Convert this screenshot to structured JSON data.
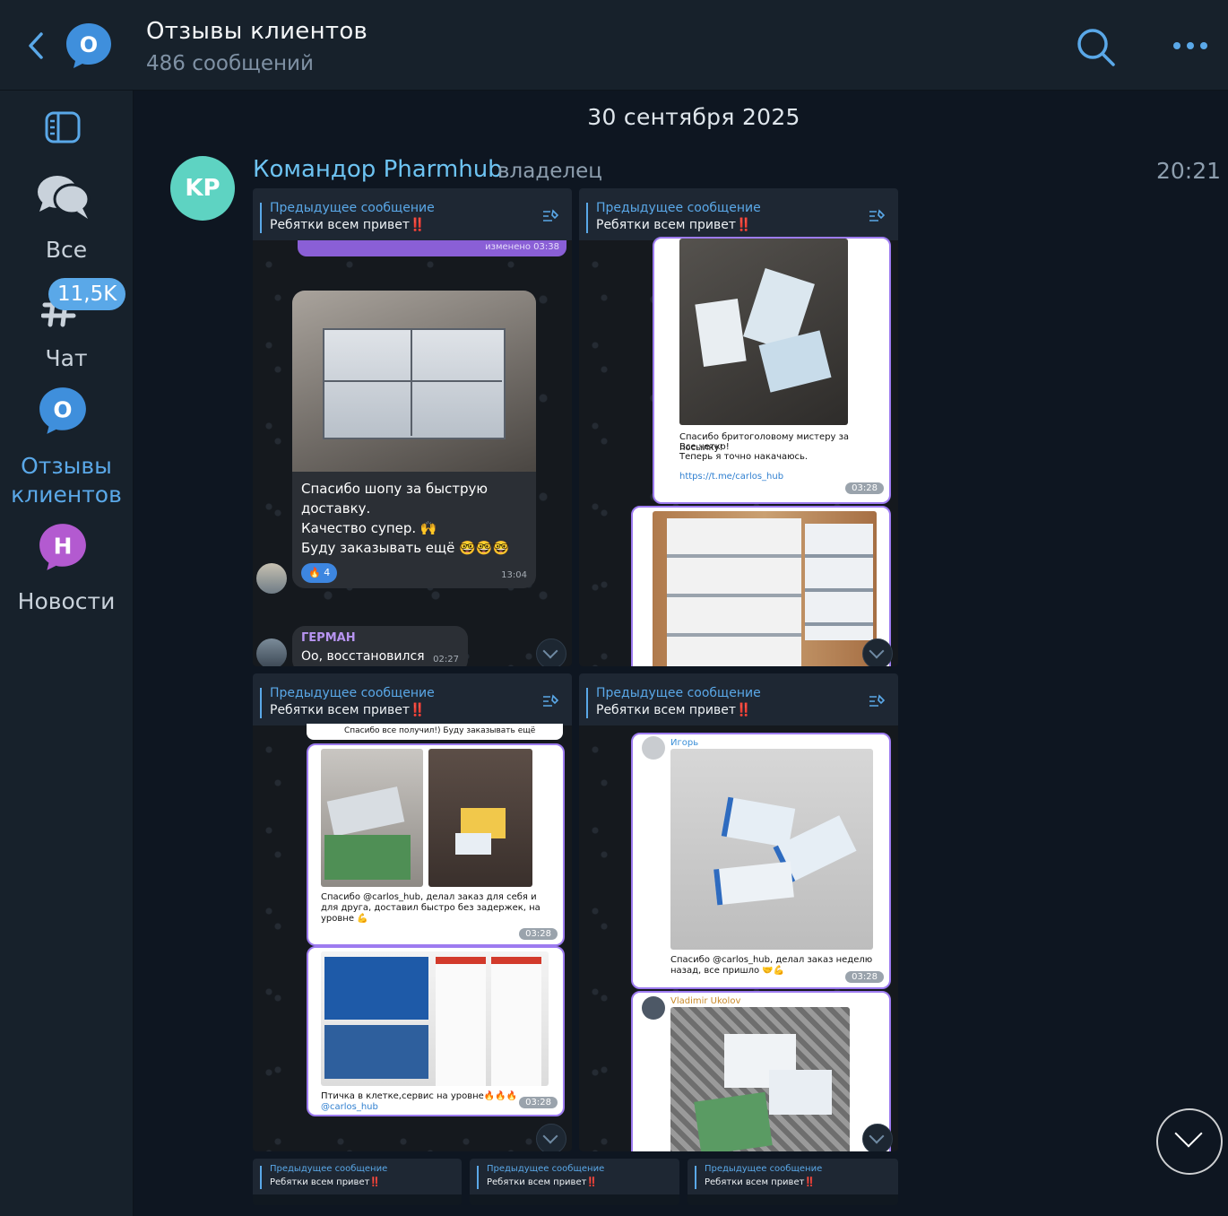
{
  "header": {
    "title": "Отзывы клиентов",
    "subtitle": "486 сообщений",
    "avatar_letter": "О"
  },
  "sidebar": {
    "folders": [
      {
        "label": "Все",
        "icon": "chats-icon"
      },
      {
        "label": "Чат",
        "icon": "hashtag-icon",
        "badge": "11,5K"
      },
      {
        "label": "Отзывы клиентов",
        "icon": "channel-avatar-o",
        "letter": "О",
        "active": true
      },
      {
        "label": "Новости",
        "icon": "channel-avatar-h",
        "letter": "Н"
      }
    ]
  },
  "chat": {
    "date": "30 сентября 2025",
    "message": {
      "avatar_initials": "KP",
      "sender": "Командор Pharmhub",
      "role": "владелец",
      "time": "20:21"
    },
    "pinned": {
      "title": "Предыдущее сообщение",
      "text": "Ребятки всем привет‼️"
    },
    "shot1": {
      "edited": "изменено 03:38",
      "caption_lines": [
        "Спасибо шопу за быструю",
        "доставку.",
        "Качество супер. 🙌",
        "Буду заказывать ещё 🤓🤓🤓"
      ],
      "reaction": "🔥 4",
      "time": "13:04",
      "reply_name": "ГЕРМАН",
      "reply_text": "Оо, восстановился",
      "reply_time": "02:27"
    },
    "shot2": {
      "caption_lines": [
        "Спасибо бритоголовому мистеру за посылку!",
        "Все четко!",
        "Теперь я точно накачаюсь."
      ],
      "link": "https://t.me/carlos_hub",
      "time": "03:28"
    },
    "shot3": {
      "top_line": "Спасибо все получил!) Буду заказывать ещё",
      "caption_lines": [
        "Спасибо @carlos_hub, делал заказ для себя и",
        "для друга, доставил быстро без задержек, на",
        "уровне 💪"
      ],
      "time": "03:28",
      "caption2": "Птичка в клетке,сервис на уровне🔥🔥🔥",
      "caption2_link": "@carlos_hub",
      "time2": "03:28"
    },
    "shot4": {
      "name": "Игорь",
      "caption_lines": [
        "Спасибо @carlos_hub, делал заказ неделю",
        "назад, все пришло 🤝💪"
      ],
      "time": "03:28",
      "name2": "Vladimir Ukolov"
    },
    "mini": {
      "title": "Предыдущее сообщение",
      "text": "Ребятки всем привет‼️"
    }
  },
  "colors": {
    "accent": "#5aa8e8",
    "background": "#0e1621",
    "sidebar": "#17212b",
    "avatar": "#5ed3c2"
  }
}
